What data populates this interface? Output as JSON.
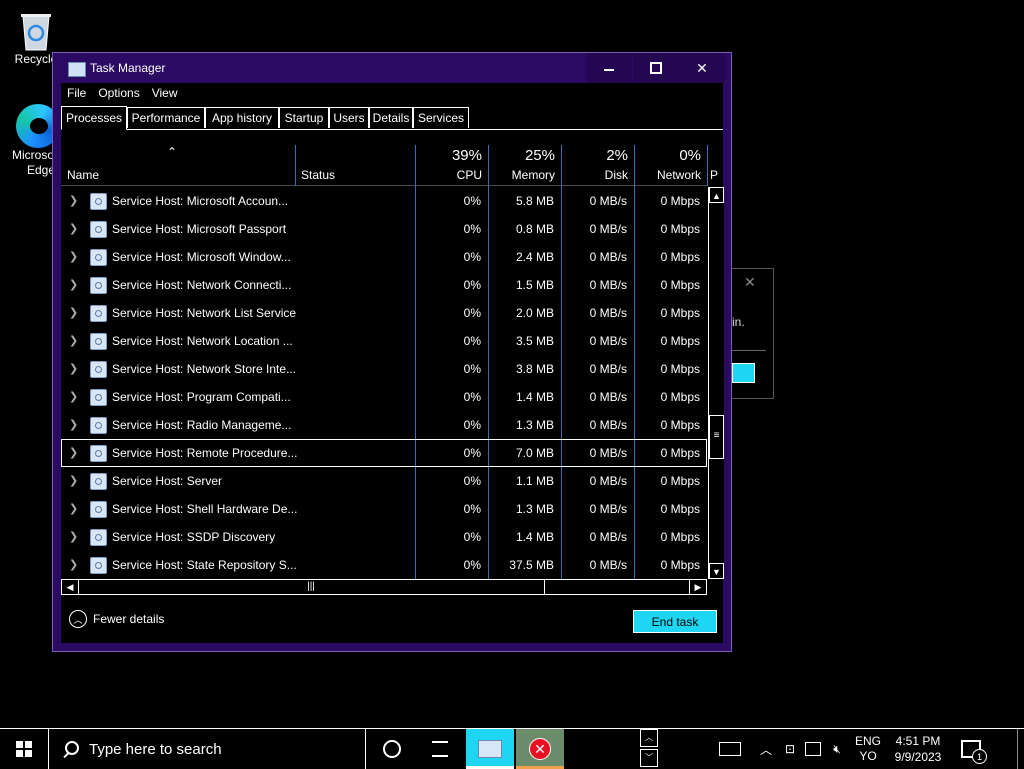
{
  "desktop": {
    "recycle_label": "Recycle",
    "edge_label_1": "Microso",
    "edge_label_2": "Edge"
  },
  "bg_dialog": {
    "text": "in."
  },
  "window": {
    "title": "Task Manager",
    "menu": [
      "File",
      "Options",
      "View"
    ],
    "tabs": [
      "Processes",
      "Performance",
      "App history",
      "Startup",
      "Users",
      "Details",
      "Services"
    ],
    "active_tab": "Processes",
    "columns": {
      "name": "Name",
      "status": "Status",
      "cpu_pct": "39%",
      "cpu": "CPU",
      "mem_pct": "25%",
      "mem": "Memory",
      "disk_pct": "2%",
      "disk": "Disk",
      "net_pct": "0%",
      "net": "Network",
      "power_partial": "P"
    },
    "rows": [
      {
        "name": "Service Host: Microsoft Accoun...",
        "cpu": "0%",
        "mem": "5.8 MB",
        "disk": "0 MB/s",
        "net": "0 Mbps"
      },
      {
        "name": "Service Host: Microsoft Passport",
        "cpu": "0%",
        "mem": "0.8 MB",
        "disk": "0 MB/s",
        "net": "0 Mbps"
      },
      {
        "name": "Service Host: Microsoft Window...",
        "cpu": "0%",
        "mem": "2.4 MB",
        "disk": "0 MB/s",
        "net": "0 Mbps"
      },
      {
        "name": "Service Host: Network Connecti...",
        "cpu": "0%",
        "mem": "1.5 MB",
        "disk": "0 MB/s",
        "net": "0 Mbps"
      },
      {
        "name": "Service Host: Network List Service",
        "cpu": "0%",
        "mem": "2.0 MB",
        "disk": "0 MB/s",
        "net": "0 Mbps"
      },
      {
        "name": "Service Host: Network Location ...",
        "cpu": "0%",
        "mem": "3.5 MB",
        "disk": "0 MB/s",
        "net": "0 Mbps"
      },
      {
        "name": "Service Host: Network Store Inte...",
        "cpu": "0%",
        "mem": "3.8 MB",
        "disk": "0 MB/s",
        "net": "0 Mbps"
      },
      {
        "name": "Service Host: Program Compati...",
        "cpu": "0%",
        "mem": "1.4 MB",
        "disk": "0 MB/s",
        "net": "0 Mbps"
      },
      {
        "name": "Service Host: Radio Manageme...",
        "cpu": "0%",
        "mem": "1.3 MB",
        "disk": "0 MB/s",
        "net": "0 Mbps"
      },
      {
        "name": "Service Host: Remote Procedure...",
        "cpu": "0%",
        "mem": "7.0 MB",
        "disk": "0 MB/s",
        "net": "0 Mbps"
      },
      {
        "name": "Service Host: Server",
        "cpu": "0%",
        "mem": "1.1 MB",
        "disk": "0 MB/s",
        "net": "0 Mbps"
      },
      {
        "name": "Service Host: Shell Hardware De...",
        "cpu": "0%",
        "mem": "1.3 MB",
        "disk": "0 MB/s",
        "net": "0 Mbps"
      },
      {
        "name": "Service Host: SSDP Discovery",
        "cpu": "0%",
        "mem": "1.4 MB",
        "disk": "0 MB/s",
        "net": "0 Mbps"
      },
      {
        "name": "Service Host: State Repository S...",
        "cpu": "0%",
        "mem": "37.5 MB",
        "disk": "0 MB/s",
        "net": "0 Mbps"
      }
    ],
    "selected_row_index": 9,
    "fewer_details": "Fewer details",
    "end_task": "End task"
  },
  "taskbar": {
    "search_placeholder": "Type here to search",
    "lang_1": "ENG",
    "lang_2": "YO",
    "time": "4:51 PM",
    "date": "9/9/2023",
    "notification_count": "1"
  },
  "colors": {
    "accent": "#1fd6f2",
    "window_frame": "#2a0a62",
    "column_separator": "#3a6fb5"
  }
}
